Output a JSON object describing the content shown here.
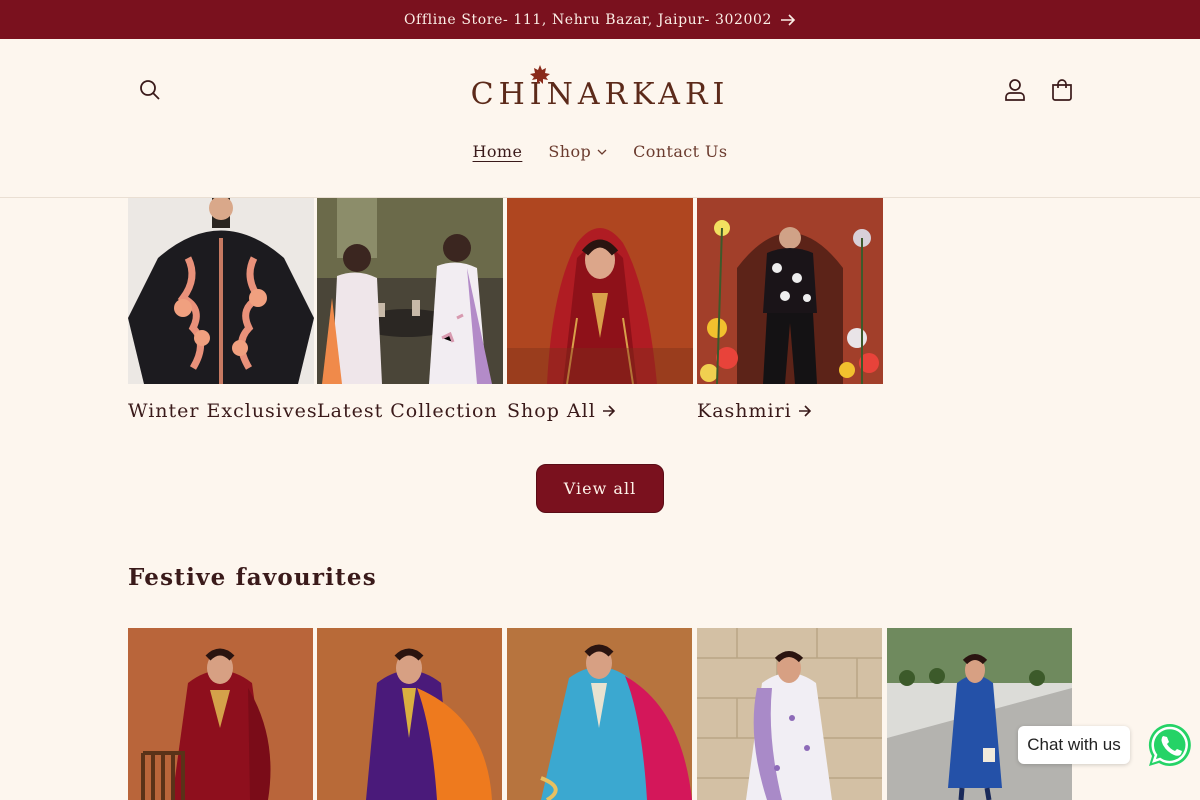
{
  "announcement": {
    "text": "Offline Store- 111, Nehru Bazar, Jaipur- 302002",
    "icon": "arrow-right-icon"
  },
  "brand": {
    "name": "CHINARKARI",
    "leaf_icon": "maple-leaf-icon",
    "color": "#5c2a1a"
  },
  "header": {
    "search_icon": "search-icon",
    "account_icon": "user-icon",
    "cart_icon": "bag-icon"
  },
  "nav": {
    "items": [
      {
        "label": "Home",
        "active": true
      },
      {
        "label": "Shop",
        "has_dropdown": true
      },
      {
        "label": "Contact Us"
      }
    ]
  },
  "collections": [
    {
      "title": "Winter Exclusives"
    },
    {
      "title": "Latest Collection"
    },
    {
      "title": "Shop All"
    },
    {
      "title": "Kashmiri"
    }
  ],
  "view_all_label": "View all",
  "section": {
    "title": "Festive favourites"
  },
  "chat": {
    "label": "Chat with us",
    "icon": "whatsapp-icon"
  },
  "colors": {
    "primary": "#7a111e",
    "background": "#fdf6ee",
    "text": "#3a1a1a",
    "whatsapp": "#25d366"
  }
}
